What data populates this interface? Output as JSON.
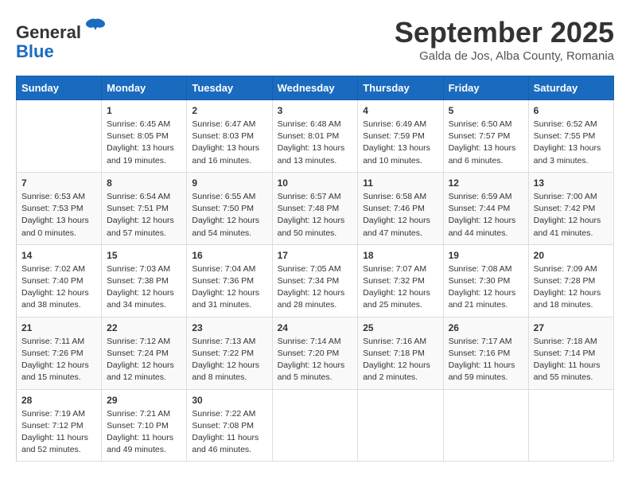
{
  "header": {
    "logo_line1": "General",
    "logo_line2": "Blue",
    "month": "September 2025",
    "location": "Galda de Jos, Alba County, Romania"
  },
  "weekdays": [
    "Sunday",
    "Monday",
    "Tuesday",
    "Wednesday",
    "Thursday",
    "Friday",
    "Saturday"
  ],
  "weeks": [
    [
      {
        "day": "",
        "info": ""
      },
      {
        "day": "1",
        "info": "Sunrise: 6:45 AM\nSunset: 8:05 PM\nDaylight: 13 hours\nand 19 minutes."
      },
      {
        "day": "2",
        "info": "Sunrise: 6:47 AM\nSunset: 8:03 PM\nDaylight: 13 hours\nand 16 minutes."
      },
      {
        "day": "3",
        "info": "Sunrise: 6:48 AM\nSunset: 8:01 PM\nDaylight: 13 hours\nand 13 minutes."
      },
      {
        "day": "4",
        "info": "Sunrise: 6:49 AM\nSunset: 7:59 PM\nDaylight: 13 hours\nand 10 minutes."
      },
      {
        "day": "5",
        "info": "Sunrise: 6:50 AM\nSunset: 7:57 PM\nDaylight: 13 hours\nand 6 minutes."
      },
      {
        "day": "6",
        "info": "Sunrise: 6:52 AM\nSunset: 7:55 PM\nDaylight: 13 hours\nand 3 minutes."
      }
    ],
    [
      {
        "day": "7",
        "info": "Sunrise: 6:53 AM\nSunset: 7:53 PM\nDaylight: 13 hours\nand 0 minutes."
      },
      {
        "day": "8",
        "info": "Sunrise: 6:54 AM\nSunset: 7:51 PM\nDaylight: 12 hours\nand 57 minutes."
      },
      {
        "day": "9",
        "info": "Sunrise: 6:55 AM\nSunset: 7:50 PM\nDaylight: 12 hours\nand 54 minutes."
      },
      {
        "day": "10",
        "info": "Sunrise: 6:57 AM\nSunset: 7:48 PM\nDaylight: 12 hours\nand 50 minutes."
      },
      {
        "day": "11",
        "info": "Sunrise: 6:58 AM\nSunset: 7:46 PM\nDaylight: 12 hours\nand 47 minutes."
      },
      {
        "day": "12",
        "info": "Sunrise: 6:59 AM\nSunset: 7:44 PM\nDaylight: 12 hours\nand 44 minutes."
      },
      {
        "day": "13",
        "info": "Sunrise: 7:00 AM\nSunset: 7:42 PM\nDaylight: 12 hours\nand 41 minutes."
      }
    ],
    [
      {
        "day": "14",
        "info": "Sunrise: 7:02 AM\nSunset: 7:40 PM\nDaylight: 12 hours\nand 38 minutes."
      },
      {
        "day": "15",
        "info": "Sunrise: 7:03 AM\nSunset: 7:38 PM\nDaylight: 12 hours\nand 34 minutes."
      },
      {
        "day": "16",
        "info": "Sunrise: 7:04 AM\nSunset: 7:36 PM\nDaylight: 12 hours\nand 31 minutes."
      },
      {
        "day": "17",
        "info": "Sunrise: 7:05 AM\nSunset: 7:34 PM\nDaylight: 12 hours\nand 28 minutes."
      },
      {
        "day": "18",
        "info": "Sunrise: 7:07 AM\nSunset: 7:32 PM\nDaylight: 12 hours\nand 25 minutes."
      },
      {
        "day": "19",
        "info": "Sunrise: 7:08 AM\nSunset: 7:30 PM\nDaylight: 12 hours\nand 21 minutes."
      },
      {
        "day": "20",
        "info": "Sunrise: 7:09 AM\nSunset: 7:28 PM\nDaylight: 12 hours\nand 18 minutes."
      }
    ],
    [
      {
        "day": "21",
        "info": "Sunrise: 7:11 AM\nSunset: 7:26 PM\nDaylight: 12 hours\nand 15 minutes."
      },
      {
        "day": "22",
        "info": "Sunrise: 7:12 AM\nSunset: 7:24 PM\nDaylight: 12 hours\nand 12 minutes."
      },
      {
        "day": "23",
        "info": "Sunrise: 7:13 AM\nSunset: 7:22 PM\nDaylight: 12 hours\nand 8 minutes."
      },
      {
        "day": "24",
        "info": "Sunrise: 7:14 AM\nSunset: 7:20 PM\nDaylight: 12 hours\nand 5 minutes."
      },
      {
        "day": "25",
        "info": "Sunrise: 7:16 AM\nSunset: 7:18 PM\nDaylight: 12 hours\nand 2 minutes."
      },
      {
        "day": "26",
        "info": "Sunrise: 7:17 AM\nSunset: 7:16 PM\nDaylight: 11 hours\nand 59 minutes."
      },
      {
        "day": "27",
        "info": "Sunrise: 7:18 AM\nSunset: 7:14 PM\nDaylight: 11 hours\nand 55 minutes."
      }
    ],
    [
      {
        "day": "28",
        "info": "Sunrise: 7:19 AM\nSunset: 7:12 PM\nDaylight: 11 hours\nand 52 minutes."
      },
      {
        "day": "29",
        "info": "Sunrise: 7:21 AM\nSunset: 7:10 PM\nDaylight: 11 hours\nand 49 minutes."
      },
      {
        "day": "30",
        "info": "Sunrise: 7:22 AM\nSunset: 7:08 PM\nDaylight: 11 hours\nand 46 minutes."
      },
      {
        "day": "",
        "info": ""
      },
      {
        "day": "",
        "info": ""
      },
      {
        "day": "",
        "info": ""
      },
      {
        "day": "",
        "info": ""
      }
    ]
  ]
}
